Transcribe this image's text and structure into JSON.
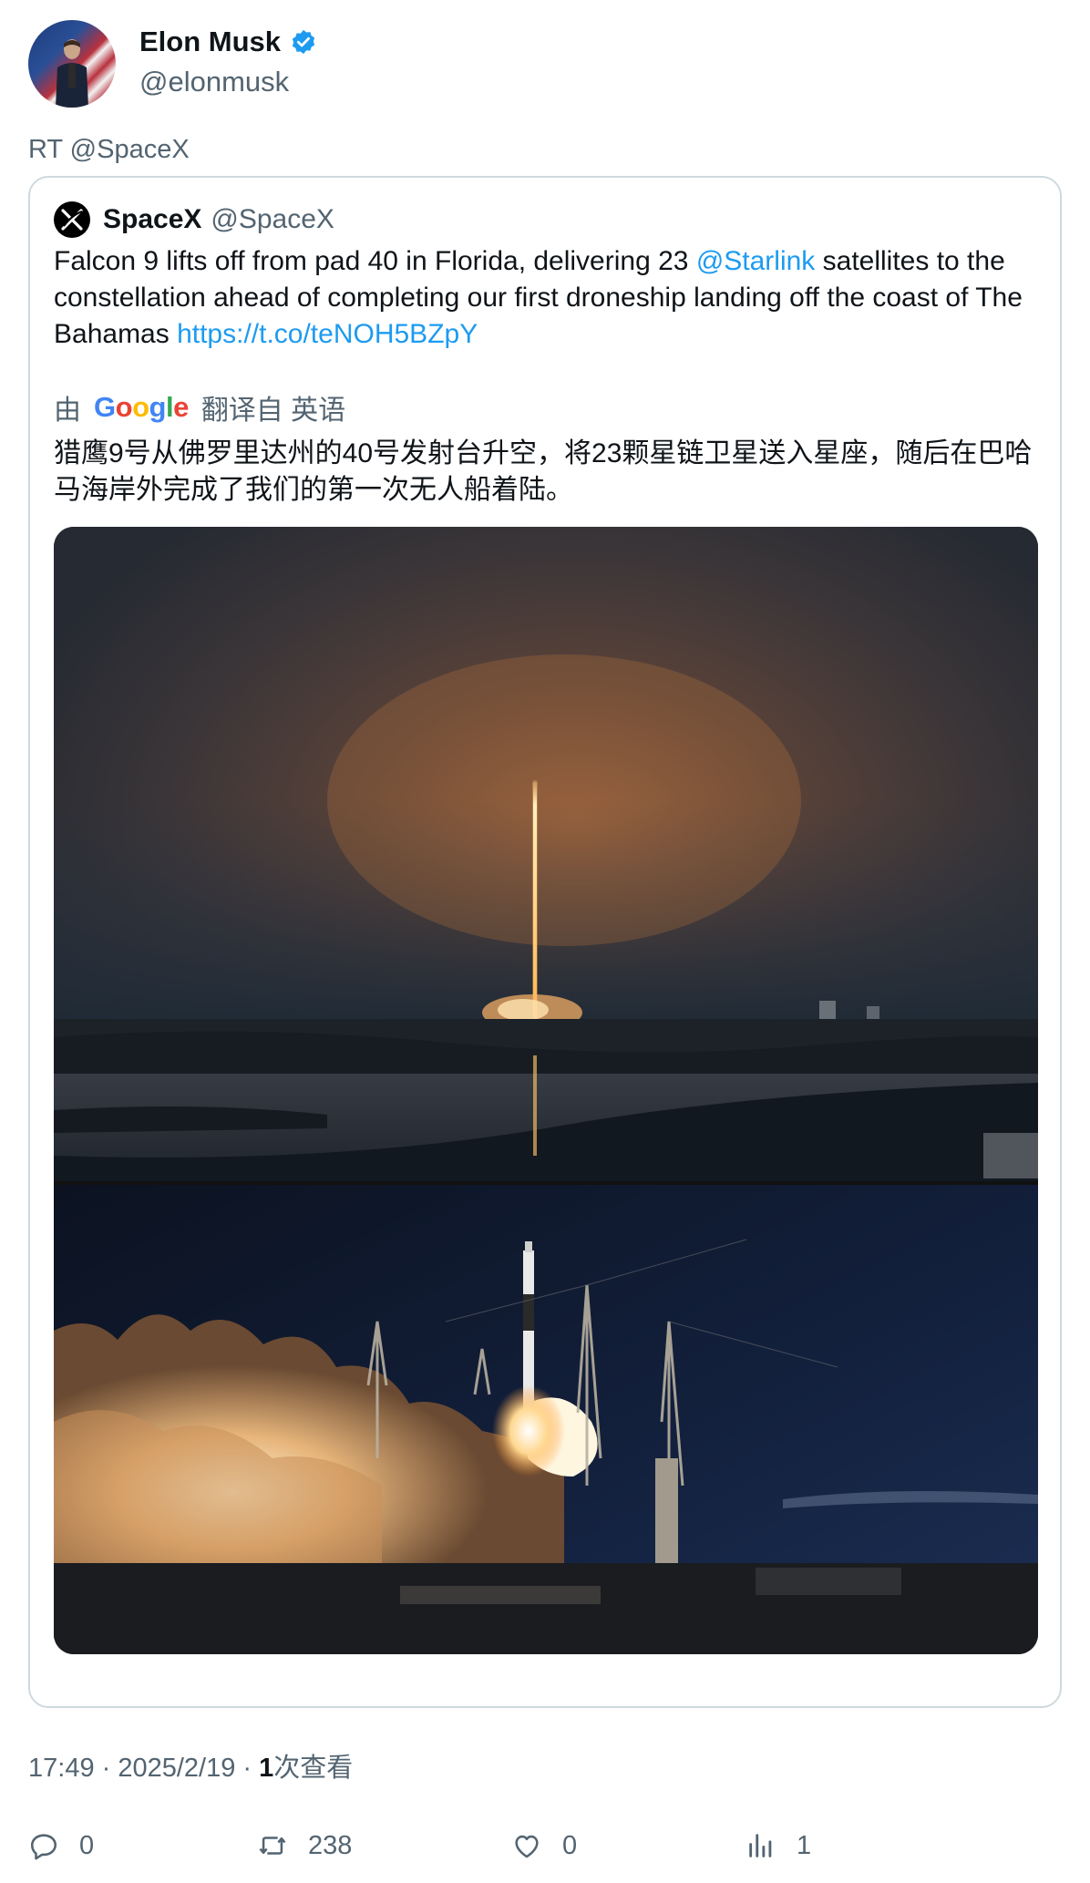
{
  "author": {
    "display_name": "Elon Musk",
    "handle": "@elonmusk"
  },
  "retweet_label": "RT @SpaceX",
  "quoted": {
    "name": "SpaceX",
    "handle": "@SpaceX",
    "text_before_mention": "Falcon 9 lifts off from pad 40 in Florida, delivering 23 ",
    "mention": "@Starlink",
    "text_after_mention": " satellites to the constellation ahead of completing our first droneship landing off the coast of The Bahamas ",
    "link": "https://t.co/teNOH5BZpY",
    "translate_prefix": "由",
    "translate_provider": "Google",
    "translate_suffix": "翻译自 英语",
    "translated_text": "猎鹰9号从佛罗里达州的40号发射台升空，将23颗星链卫星送入星座，随后在巴哈马海岸外完成了我们的第一次无人船着陆。"
  },
  "meta": {
    "time": "17:49",
    "sep1": " · ",
    "date": "2025/2/19",
    "sep2": " · ",
    "views_count": "1",
    "views_label": "次查看"
  },
  "actions": {
    "replies": "0",
    "retweets": "238",
    "likes": "0",
    "views": "1"
  },
  "icons": [
    "verified-badge-icon",
    "spacex-logo-icon",
    "reply-icon",
    "retweet-icon",
    "like-icon",
    "views-icon"
  ],
  "colors": {
    "link": "#1d9bf0",
    "secondary_text": "#536471",
    "border": "#cfd9de"
  }
}
